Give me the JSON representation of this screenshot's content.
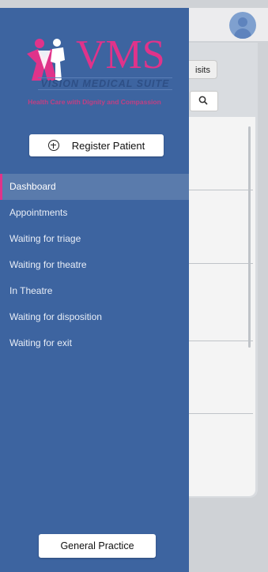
{
  "background": {
    "tab_label": "isits"
  },
  "drawer": {
    "logo": {
      "brand": "VMS",
      "subtitle": "VISION MEDICAL SUITE",
      "tagline": "Health Care with Dignity and Compassion"
    },
    "register_button_label": "Register Patient",
    "menu": [
      {
        "label": "Dashboard",
        "active": true
      },
      {
        "label": "Appointments",
        "active": false
      },
      {
        "label": "Waiting for triage",
        "active": false
      },
      {
        "label": "Waiting for theatre",
        "active": false
      },
      {
        "label": "In Theatre",
        "active": false
      },
      {
        "label": "Waiting for disposition",
        "active": false
      },
      {
        "label": "Waiting for exit",
        "active": false
      }
    ],
    "footer_button_label": "General Practice"
  },
  "colors": {
    "drawer_bg": "#3d64a0",
    "brand_pink": "#e0338a",
    "active_item_bg": "#5a7bac"
  },
  "icons": [
    "user-avatar-icon",
    "search-icon",
    "add-circle-icon",
    "vms-logo-icon"
  ]
}
